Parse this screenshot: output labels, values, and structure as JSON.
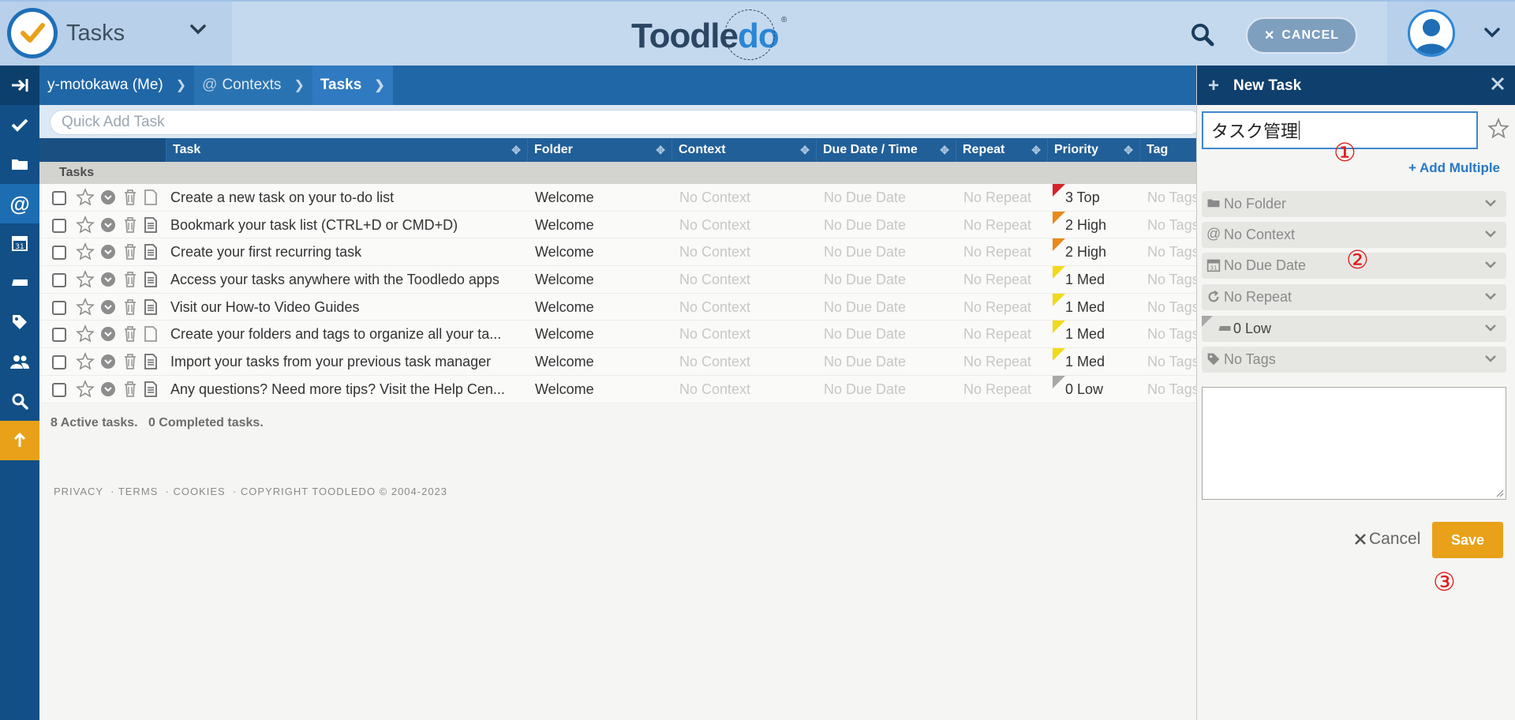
{
  "header": {
    "app_title": "Tasks",
    "brand_part1": "Toodle",
    "brand_part2": "do",
    "brand_reg": "®",
    "cancel_label": "CANCEL"
  },
  "breadcrumb": [
    {
      "label": "y-motokawa (Me)"
    },
    {
      "label": "Contexts"
    },
    {
      "label": "Tasks"
    }
  ],
  "quick_add": {
    "placeholder": "Quick Add Task"
  },
  "columns": {
    "task": "Task",
    "folder": "Folder",
    "context": "Context",
    "due": "Due Date / Time",
    "repeat": "Repeat",
    "priority": "Priority",
    "tag": "Tag"
  },
  "group_label": "Tasks",
  "tasks": [
    {
      "name": "Create a new task on your to-do list",
      "folder": "Welcome",
      "context": "No Context",
      "due": "No Due Date",
      "repeat": "No Repeat",
      "priority": "3 Top",
      "tag": "No Tags",
      "flag_color": "#d8222a"
    },
    {
      "name": "Bookmark your task list (CTRL+D or CMD+D)",
      "folder": "Welcome",
      "context": "No Context",
      "due": "No Due Date",
      "repeat": "No Repeat",
      "priority": "2 High",
      "tag": "No Tags",
      "flag_color": "#e8891c"
    },
    {
      "name": "Create your first recurring task",
      "folder": "Welcome",
      "context": "No Context",
      "due": "No Due Date",
      "repeat": "No Repeat",
      "priority": "2 High",
      "tag": "No Tags",
      "flag_color": "#e8891c"
    },
    {
      "name": "Access your tasks anywhere with the Toodledo apps",
      "folder": "Welcome",
      "context": "No Context",
      "due": "No Due Date",
      "repeat": "No Repeat",
      "priority": "1 Med",
      "tag": "No Tags",
      "flag_color": "#f2d91a"
    },
    {
      "name": "Visit our How-to Video Guides",
      "folder": "Welcome",
      "context": "No Context",
      "due": "No Due Date",
      "repeat": "No Repeat",
      "priority": "1 Med",
      "tag": "No Tags",
      "flag_color": "#f2d91a"
    },
    {
      "name": "Create your folders and tags to organize all your ta...",
      "folder": "Welcome",
      "context": "No Context",
      "due": "No Due Date",
      "repeat": "No Repeat",
      "priority": "1 Med",
      "tag": "No Tags",
      "flag_color": "#f2d91a"
    },
    {
      "name": "Import your tasks from your previous task manager",
      "folder": "Welcome",
      "context": "No Context",
      "due": "No Due Date",
      "repeat": "No Repeat",
      "priority": "1 Med",
      "tag": "No Tags",
      "flag_color": "#f2d91a"
    },
    {
      "name": "Any questions? Need more tips? Visit the Help Cen...",
      "folder": "Welcome",
      "context": "No Context",
      "due": "No Due Date",
      "repeat": "No Repeat",
      "priority": "0 Low",
      "tag": "No Tags",
      "flag_color": "#a8a8a8"
    }
  ],
  "summary": {
    "active": "8 Active tasks.",
    "completed": "0 Completed tasks."
  },
  "footer": {
    "privacy": "PRIVACY",
    "terms": "TERMS",
    "cookies": "COOKIES",
    "copyright": "COPYRIGHT TOODLEDO © 2004-2023"
  },
  "panel": {
    "title": "New Task",
    "task_title_value": "タスク管理",
    "add_multiple": "+ Add Multiple",
    "folder": "No Folder",
    "context": "No Context",
    "due": "No Due Date",
    "repeat": "No Repeat",
    "priority": "0 Low",
    "tags": "No Tags",
    "cancel_label": "Cancel",
    "save_label": "Save"
  },
  "annotations": {
    "a1": "①",
    "a2": "②",
    "a3": "③"
  },
  "colors": {
    "accent": "#1f67a7",
    "save": "#e8a118",
    "annotation": "#e01b1b"
  }
}
